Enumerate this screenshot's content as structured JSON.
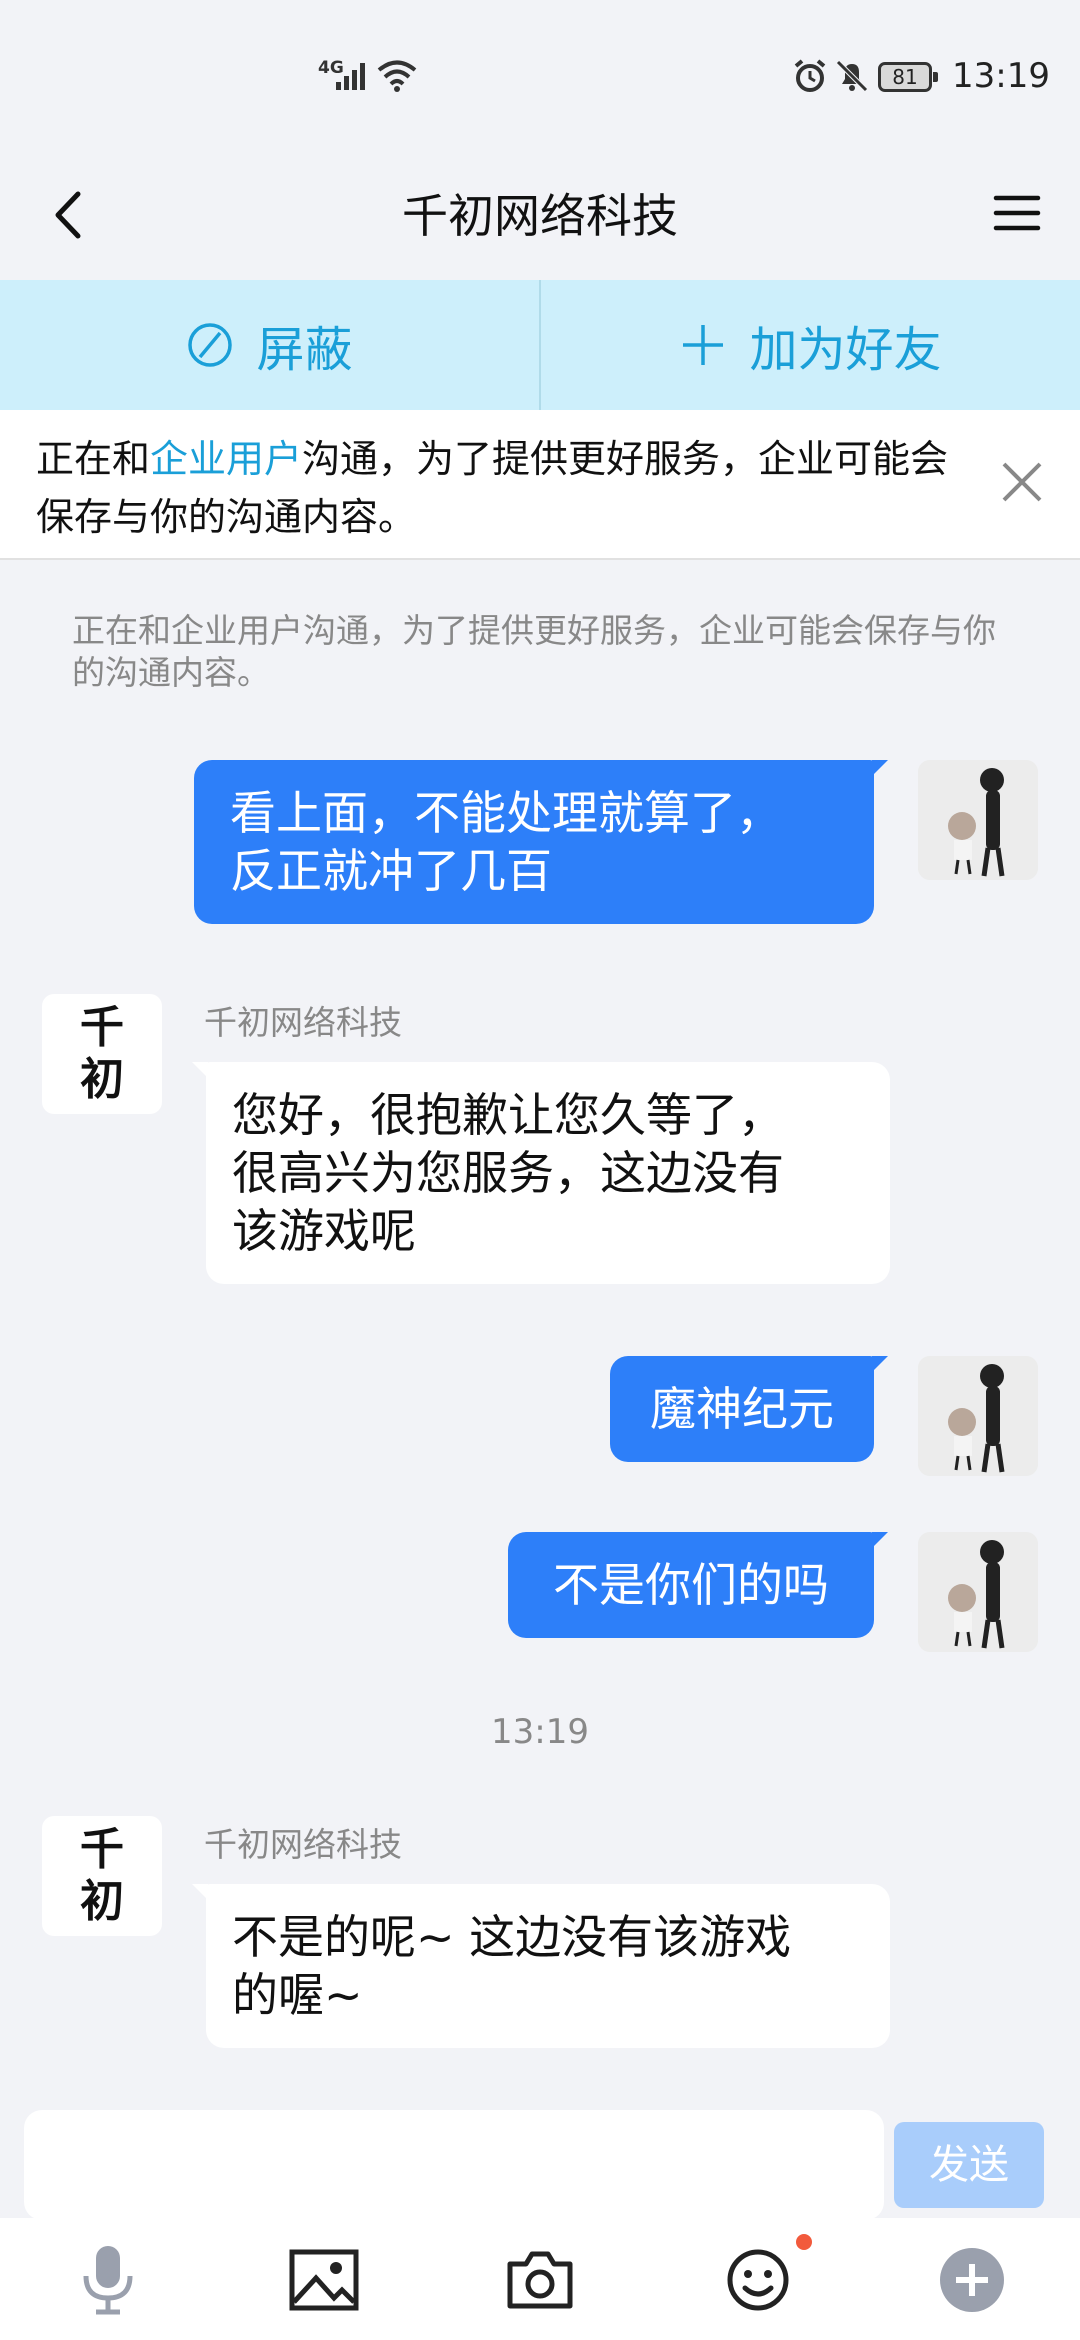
{
  "status_bar": {
    "network": "4G",
    "battery": "81",
    "time": "13:19"
  },
  "header": {
    "title": "千初网络科技"
  },
  "actions": {
    "block_label": "屏蔽",
    "add_friend_label": "加为好友"
  },
  "notice": {
    "text_before": "正在和",
    "highlight": "企业用户",
    "text_after": "沟通，为了提供更好服务，企业可能会保存与你的沟通内容。"
  },
  "system_message": "正在和企业用户沟通，为了提供更好服务，企业可能会保存与你的沟通内容。",
  "messages": [
    {
      "from": "me",
      "text": "看上面，不能处理就算了，\n反正就冲了几百"
    },
    {
      "from": "them",
      "sender": "千初网络科技",
      "text": "您好，很抱歉让您久等了，\n很高兴为您服务，这边没有\n该游戏呢"
    },
    {
      "from": "me",
      "text": "魔神纪元"
    },
    {
      "from": "me",
      "text": "不是你们的吗"
    },
    {
      "from": "them",
      "sender": "千初网络科技",
      "text": "不是的呢~ 这边没有该游戏\n的喔~"
    }
  ],
  "timestamp": "13:19",
  "avatar_them_text": "千\n初",
  "composer": {
    "send_label": "发送",
    "input_value": ""
  },
  "toolbar": {
    "icons": [
      "microphone-icon",
      "image-icon",
      "camera-icon",
      "emoji-icon",
      "plus-icon"
    ]
  },
  "colors": {
    "accent": "#1a9fd8",
    "bubble_me": "#2d7ff9",
    "send_disabled": "#a9cdfb",
    "badge": "#f25a3c"
  }
}
